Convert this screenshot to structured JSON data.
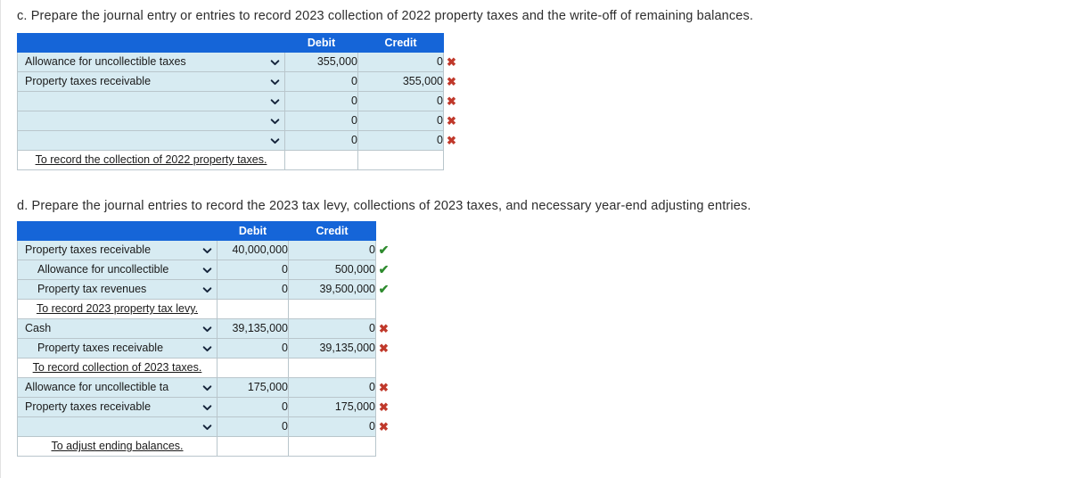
{
  "prompts": {
    "c": "c. Prepare the journal entry or entries to record 2023 collection of 2022 property taxes and the write-off of remaining balances.",
    "d": "d. Prepare the journal entries to record the 2023 tax levy, collections of 2023 taxes, and necessary year-end adjusting entries."
  },
  "colors": {
    "header_blue": "#1565d8",
    "row_blue": "#d7ebf2",
    "border": "#b9c6cc",
    "wrong_red": "#c0392b",
    "right_green": "#2e8b2e"
  },
  "table_c": {
    "headers": {
      "account": "",
      "debit": "Debit",
      "credit": "Credit"
    },
    "rows": [
      {
        "type": "entry",
        "account": "Allowance for uncollectible taxes",
        "indent": 0,
        "debit": "355,000",
        "credit": "0",
        "mark": "wrong",
        "mark_glyph": "✖"
      },
      {
        "type": "entry",
        "account": "Property taxes receivable",
        "indent": 0,
        "debit": "0",
        "credit": "355,000",
        "mark": "wrong",
        "mark_glyph": "✖"
      },
      {
        "type": "entry",
        "account": "",
        "indent": 0,
        "debit": "0",
        "credit": "0",
        "mark": "wrong",
        "mark_glyph": "✖"
      },
      {
        "type": "entry",
        "account": "",
        "indent": 0,
        "debit": "0",
        "credit": "0",
        "mark": "wrong",
        "mark_glyph": "✖"
      },
      {
        "type": "entry",
        "account": "",
        "indent": 0,
        "debit": "0",
        "credit": "0",
        "mark": "wrong",
        "mark_glyph": "✖"
      },
      {
        "type": "memo",
        "account": "To record the collection of 2022 property taxes.",
        "indent": 0,
        "debit": "",
        "credit": "",
        "mark": "none",
        "mark_glyph": ""
      }
    ]
  },
  "table_d": {
    "headers": {
      "account": "",
      "debit": "Debit",
      "credit": "Credit"
    },
    "rows": [
      {
        "type": "entry",
        "account": "Property taxes receivable",
        "indent": 0,
        "debit": "40,000,000",
        "credit": "0",
        "mark": "right",
        "mark_glyph": "✔"
      },
      {
        "type": "entry",
        "account": "Allowance for uncollectible",
        "indent": 1,
        "debit": "0",
        "credit": "500,000",
        "mark": "right",
        "mark_glyph": "✔"
      },
      {
        "type": "entry",
        "account": "Property tax revenues",
        "indent": 1,
        "debit": "0",
        "credit": "39,500,000",
        "mark": "right",
        "mark_glyph": "✔"
      },
      {
        "type": "memo",
        "account": "To record 2023 property tax levy.",
        "indent": 0,
        "debit": "",
        "credit": "",
        "mark": "none",
        "mark_glyph": ""
      },
      {
        "type": "entry",
        "account": "Cash",
        "indent": 0,
        "debit": "39,135,000",
        "credit": "0",
        "mark": "wrong",
        "mark_glyph": "✖"
      },
      {
        "type": "entry",
        "account": "Property taxes receivable",
        "indent": 1,
        "debit": "0",
        "credit": "39,135,000",
        "mark": "wrong",
        "mark_glyph": "✖"
      },
      {
        "type": "memo",
        "account": "To record collection of 2023 taxes.",
        "indent": 0,
        "debit": "",
        "credit": "",
        "mark": "none",
        "mark_glyph": ""
      },
      {
        "type": "entry",
        "account": "Allowance for uncollectible ta",
        "indent": 0,
        "debit": "175,000",
        "credit": "0",
        "mark": "wrong",
        "mark_glyph": "✖"
      },
      {
        "type": "entry",
        "account": "Property taxes receivable",
        "indent": 0,
        "debit": "0",
        "credit": "175,000",
        "mark": "wrong",
        "mark_glyph": "✖"
      },
      {
        "type": "entry",
        "account": "",
        "indent": 0,
        "debit": "0",
        "credit": "0",
        "mark": "wrong",
        "mark_glyph": "✖"
      },
      {
        "type": "memo",
        "account": "To adjust ending balances.",
        "indent": 0,
        "debit": "",
        "credit": "",
        "mark": "none",
        "mark_glyph": ""
      }
    ]
  }
}
